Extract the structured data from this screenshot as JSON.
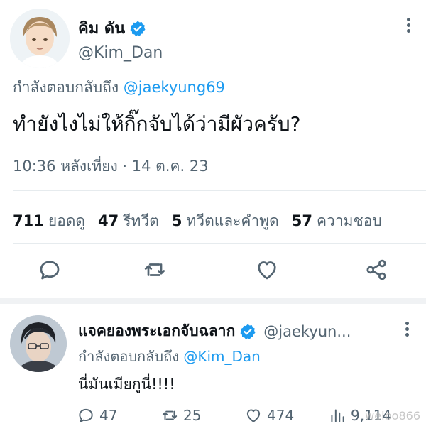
{
  "main_tweet": {
    "display_name": "คิม ดัน",
    "handle": "@Kim_Dan",
    "reply_prefix": "กำลังตอบกลับถึง",
    "reply_mention": "@jaekyung69",
    "text": "ทำยังไงไม่ให้กิ๊กจับได้ว่ามีผัวครับ?",
    "timestamp": "10:36 หลังเที่ยง · 14 ต.ค. 23",
    "stats": [
      {
        "value": "711",
        "label": "ยอดดู"
      },
      {
        "value": "47",
        "label": "รีทวีต"
      },
      {
        "value": "5",
        "label": "ทวีตและคำพูด"
      },
      {
        "value": "57",
        "label": "ความชอบ"
      }
    ],
    "actions": [
      "reply-icon",
      "retweet-icon",
      "like-icon",
      "share-icon"
    ]
  },
  "reply_tweet": {
    "display_name": "แจคยองพระเอกจับฉลาก",
    "handle": "@jaekyun...",
    "reply_prefix": "กำลังตอบกลับถึง",
    "reply_mention": "@Kim_Dan",
    "text": "นี่มันเมียกูนี่!!!!",
    "counts": {
      "replies": "47",
      "retweets": "25",
      "likes": "474",
      "views": "9,114"
    }
  },
  "watermark": "weibo866",
  "colors": {
    "accent": "#1d9bf0",
    "text": "#0f1419",
    "muted": "#536471",
    "divider": "#e6ebee"
  }
}
